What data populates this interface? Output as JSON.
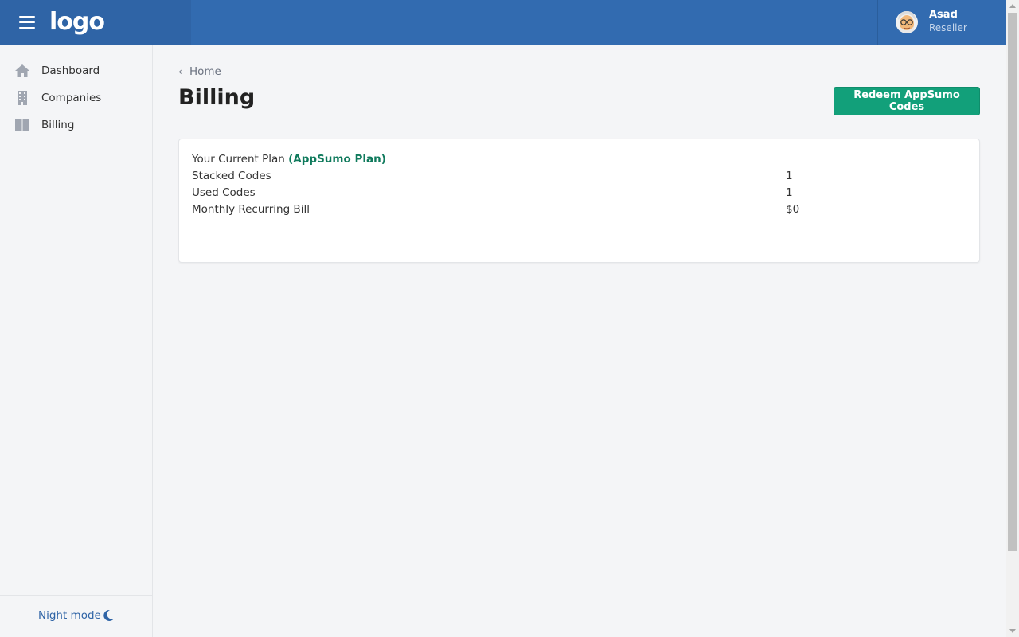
{
  "header": {
    "logo_text": "logo",
    "user": {
      "name": "Asad",
      "role": "Reseller"
    }
  },
  "sidebar": {
    "items": [
      {
        "label": "Dashboard",
        "icon": "home-icon"
      },
      {
        "label": "Companies",
        "icon": "building-icon"
      },
      {
        "label": "Billing",
        "icon": "book-icon"
      }
    ],
    "night_mode_label": "Night mode"
  },
  "main": {
    "breadcrumb": "Home",
    "title": "Billing",
    "redeem_button": "Redeem AppSumo Codes",
    "plan": {
      "label": "Your Current Plan",
      "name": "(AppSumo Plan)",
      "rows": [
        {
          "label": "Stacked Codes",
          "value": "1"
        },
        {
          "label": "Used Codes",
          "value": "1"
        },
        {
          "label": "Monthly Recurring Bill",
          "value": "$0"
        }
      ]
    }
  },
  "colors": {
    "header_bg": "#326bb0",
    "accent_green": "#12a07a",
    "plan_name": "#0f7a5c"
  }
}
